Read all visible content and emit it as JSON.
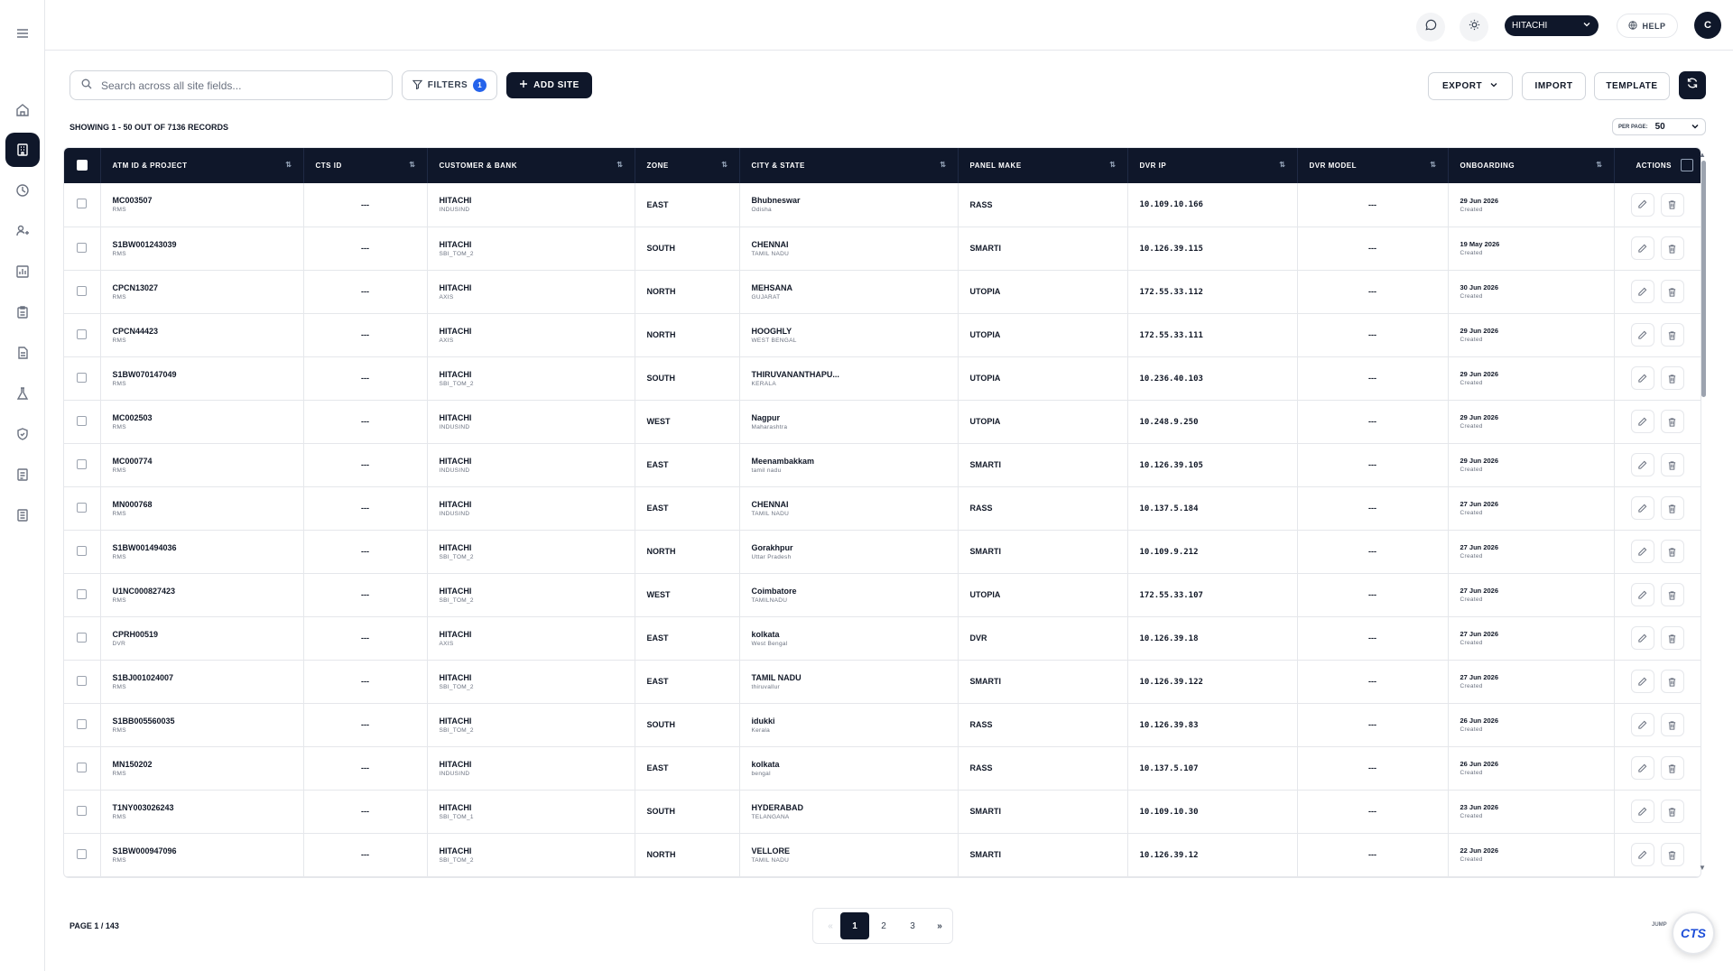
{
  "sidebar": {
    "items": [
      {
        "name": "menu-icon"
      },
      {
        "name": "home-icon"
      },
      {
        "name": "building-icon"
      },
      {
        "name": "clock-icon"
      },
      {
        "name": "user-route-icon"
      },
      {
        "name": "report-icon"
      },
      {
        "name": "clipboard-icon"
      },
      {
        "name": "document-icon"
      },
      {
        "name": "lab-icon"
      },
      {
        "name": "shield-icon"
      },
      {
        "name": "list-icon"
      },
      {
        "name": "file-list-icon"
      }
    ]
  },
  "topbar": {
    "org_select": "HITACHI",
    "help_label": "HELP",
    "avatar_initial": "C"
  },
  "toolbar": {
    "search_placeholder": "Search across all site fields...",
    "filters_label": "FILTERS",
    "filters_count": "1",
    "add_site_label": "ADD SITE",
    "export_label": "EXPORT",
    "import_label": "IMPORT",
    "template_label": "TEMPLATE"
  },
  "records_text": "SHOWING 1 - 50 OUT OF 7136 RECORDS",
  "per_page": {
    "label": "PER PAGE:",
    "value": "50"
  },
  "table": {
    "headers": [
      "ATM ID & PROJECT",
      "CTS ID",
      "CUSTOMER & BANK",
      "ZONE",
      "CITY & STATE",
      "PANEL MAKE",
      "DVR IP",
      "DVR MODEL",
      "ONBOARDING",
      "ACTIONS"
    ],
    "rows": [
      {
        "atm": "MC003507",
        "project": "RMS",
        "cts": "---",
        "customer": "HITACHI",
        "bank": "INDUSIND",
        "zone": "EAST",
        "city": "Bhubneswar",
        "state": "Odisha",
        "panel": "RASS",
        "ip": "10.109.10.166",
        "model": "---",
        "date": "29 Jun 2026",
        "status": "Created"
      },
      {
        "atm": "S1BW001243039",
        "project": "RMS",
        "cts": "---",
        "customer": "HITACHI",
        "bank": "SBI_TOM_2",
        "zone": "SOUTH",
        "city": "CHENNAI",
        "state": "TAMIL NADU",
        "panel": "SMARTI",
        "ip": "10.126.39.115",
        "model": "---",
        "date": "19 May 2026",
        "status": "Created"
      },
      {
        "atm": "CPCN13027",
        "project": "RMS",
        "cts": "---",
        "customer": "HITACHI",
        "bank": "AXIS",
        "zone": "NORTH",
        "city": "MEHSANA",
        "state": "GUJARAT",
        "panel": "UTOPIA",
        "ip": "172.55.33.112",
        "model": "---",
        "date": "30 Jun 2026",
        "status": "Created"
      },
      {
        "atm": "CPCN44423",
        "project": "RMS",
        "cts": "---",
        "customer": "HITACHI",
        "bank": "AXIS",
        "zone": "NORTH",
        "city": "HOOGHLY",
        "state": "WEST BENGAL",
        "panel": "UTOPIA",
        "ip": "172.55.33.111",
        "model": "---",
        "date": "29 Jun 2026",
        "status": "Created"
      },
      {
        "atm": "S1BW070147049",
        "project": "RMS",
        "cts": "---",
        "customer": "HITACHI",
        "bank": "SBI_TOM_2",
        "zone": "SOUTH",
        "city": "THIRUVANANTHAPU...",
        "state": "KERALA",
        "panel": "UTOPIA",
        "ip": "10.236.40.103",
        "model": "---",
        "date": "29 Jun 2026",
        "status": "Created"
      },
      {
        "atm": "MC002503",
        "project": "RMS",
        "cts": "---",
        "customer": "HITACHI",
        "bank": "INDUSIND",
        "zone": "WEST",
        "city": "Nagpur",
        "state": "Maharashtra",
        "panel": "UTOPIA",
        "ip": "10.248.9.250",
        "model": "---",
        "date": "29 Jun 2026",
        "status": "Created"
      },
      {
        "atm": "MC000774",
        "project": "RMS",
        "cts": "---",
        "customer": "HITACHI",
        "bank": "INDUSIND",
        "zone": "EAST",
        "city": "Meenambakkam",
        "state": "tamil nadu",
        "panel": "SMARTI",
        "ip": "10.126.39.105",
        "model": "---",
        "date": "29 Jun 2026",
        "status": "Created"
      },
      {
        "atm": "MN000768",
        "project": "RMS",
        "cts": "---",
        "customer": "HITACHI",
        "bank": "INDUSIND",
        "zone": "EAST",
        "city": "CHENNAI",
        "state": "TAMIL NADU",
        "panel": "RASS",
        "ip": "10.137.5.184",
        "model": "---",
        "date": "27 Jun 2026",
        "status": "Created"
      },
      {
        "atm": "S1BW001494036",
        "project": "RMS",
        "cts": "---",
        "customer": "HITACHI",
        "bank": "SBI_TOM_2",
        "zone": "NORTH",
        "city": "Gorakhpur",
        "state": "Uttar Pradesh",
        "panel": "SMARTI",
        "ip": "10.109.9.212",
        "model": "---",
        "date": "27 Jun 2026",
        "status": "Created"
      },
      {
        "atm": "U1NC000827423",
        "project": "RMS",
        "cts": "---",
        "customer": "HITACHI",
        "bank": "SBI_TOM_2",
        "zone": "WEST",
        "city": "Coimbatore",
        "state": "TAMILNADU",
        "panel": "UTOPIA",
        "ip": "172.55.33.107",
        "model": "---",
        "date": "27 Jun 2026",
        "status": "Created"
      },
      {
        "atm": "CPRH00519",
        "project": "DVR",
        "cts": "---",
        "customer": "HITACHI",
        "bank": "AXIS",
        "zone": "EAST",
        "city": "kolkata",
        "state": "West Bengal",
        "panel": "DVR",
        "ip": "10.126.39.18",
        "model": "---",
        "date": "27 Jun 2026",
        "status": "Created"
      },
      {
        "atm": "S1BJ001024007",
        "project": "RMS",
        "cts": "---",
        "customer": "HITACHI",
        "bank": "SBI_TOM_2",
        "zone": "EAST",
        "city": "TAMIL NADU",
        "state": "thiruvallur",
        "panel": "SMARTI",
        "ip": "10.126.39.122",
        "model": "---",
        "date": "27 Jun 2026",
        "status": "Created"
      },
      {
        "atm": "S1BB005560035",
        "project": "RMS",
        "cts": "---",
        "customer": "HITACHI",
        "bank": "SBI_TOM_2",
        "zone": "SOUTH",
        "city": "idukki",
        "state": "Kerala",
        "panel": "RASS",
        "ip": "10.126.39.83",
        "model": "---",
        "date": "26 Jun 2026",
        "status": "Created"
      },
      {
        "atm": "MN150202",
        "project": "RMS",
        "cts": "---",
        "customer": "HITACHI",
        "bank": "INDUSIND",
        "zone": "EAST",
        "city": "kolkata",
        "state": "bengal",
        "panel": "RASS",
        "ip": "10.137.5.107",
        "model": "---",
        "date": "26 Jun 2026",
        "status": "Created"
      },
      {
        "atm": "T1NY003026243",
        "project": "RMS",
        "cts": "---",
        "customer": "HITACHI",
        "bank": "SBI_TOM_1",
        "zone": "SOUTH",
        "city": "HYDERABAD",
        "state": "TELANGANA",
        "panel": "SMARTI",
        "ip": "10.109.10.30",
        "model": "---",
        "date": "23 Jun 2026",
        "status": "Created"
      },
      {
        "atm": "S1BW000947096",
        "project": "RMS",
        "cts": "---",
        "customer": "HITACHI",
        "bank": "SBI_TOM_2",
        "zone": "NORTH",
        "city": "VELLORE",
        "state": "TAMIL NADU",
        "panel": "SMARTI",
        "ip": "10.126.39.12",
        "model": "---",
        "date": "22 Jun 2026",
        "status": "Created"
      }
    ]
  },
  "pagination": {
    "page_info": "PAGE 1 / 143",
    "prev": "«",
    "pages": [
      "1",
      "2",
      "3"
    ],
    "next": "»",
    "jump_label": "JUMP"
  },
  "fab": {
    "logo_text": "CTS"
  }
}
